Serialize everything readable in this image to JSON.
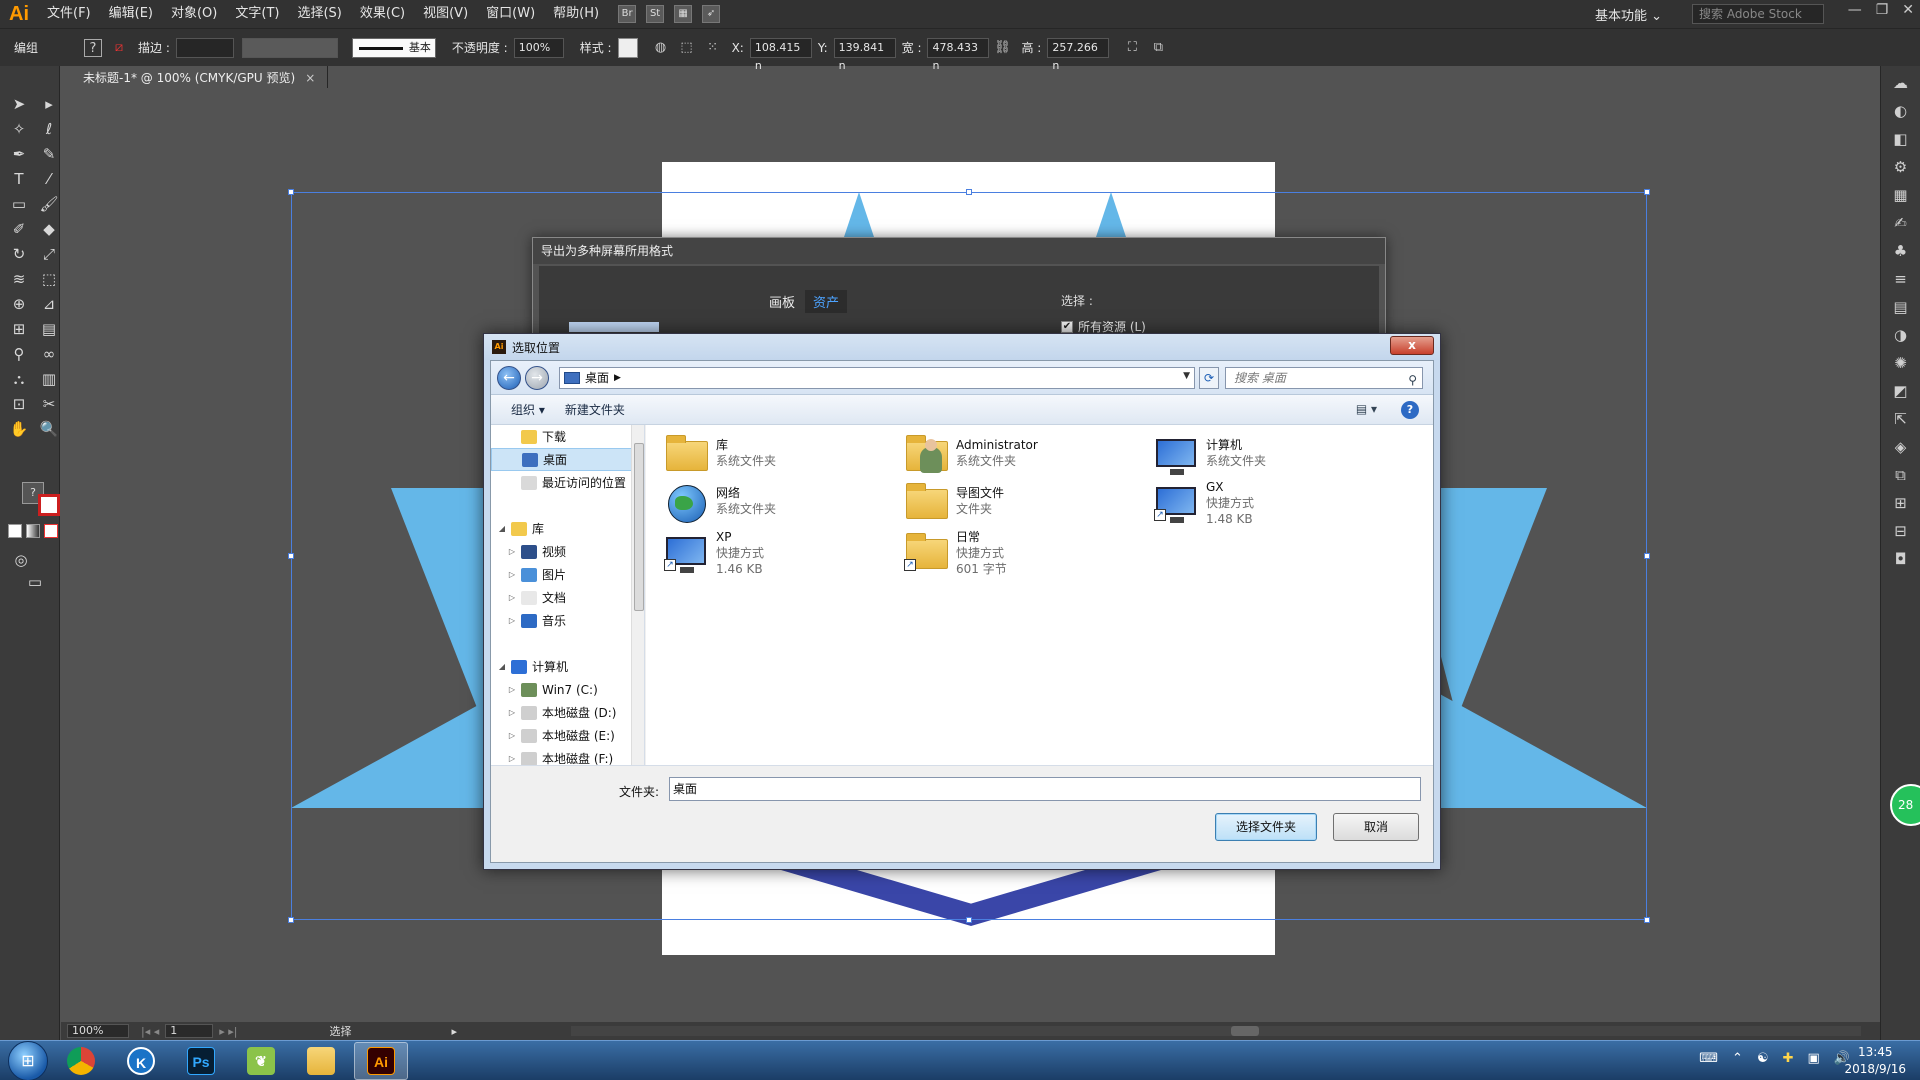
{
  "menubar": {
    "logo": "Ai",
    "items": [
      "文件(F)",
      "编辑(E)",
      "对象(O)",
      "文字(T)",
      "选择(S)",
      "效果(C)",
      "视图(V)",
      "窗口(W)",
      "帮助(H)"
    ],
    "st_label": "St",
    "workspace": "基本功能",
    "stock_search_placeholder": "搜索 Adobe Stock"
  },
  "controlbar": {
    "mode": "编组",
    "stroke_label": "描边 :",
    "stroke_style": "基本",
    "opacity_label": "不透明度 :",
    "opacity_value": "100%",
    "style_label": "样式 :",
    "x_label": "X:",
    "x_value": "108.415 n",
    "y_label": "Y:",
    "y_value": "139.841 n",
    "w_label": "宽 :",
    "w_value": "478.433 n",
    "h_label": "高 :",
    "h_value": "257.266 n"
  },
  "document": {
    "tab_title": "未标题-1* @ 100% (CMYK/GPU 预览)",
    "tab_close": "×",
    "artwork_color": "#64b7e8"
  },
  "export_dialog": {
    "title": "导出为多种屏幕所用格式",
    "tab_artboards": "画板",
    "tab_assets": "资产",
    "select_label": "选择 :",
    "all_assets_label": "所有资源 (L)",
    "all_assets_checked": true
  },
  "picker": {
    "title": "选取位置",
    "title_icon": "Ai",
    "close": "x",
    "address": "桌面",
    "search_placeholder": "搜索 桌面",
    "organize": "组织 ▾",
    "new_folder": "新建文件夹",
    "help": "?",
    "tree": [
      {
        "label": "下载",
        "indent": 1,
        "arrow": ""
      },
      {
        "label": "桌面",
        "indent": 1,
        "arrow": "",
        "selected": true
      },
      {
        "label": "最近访问的位置",
        "indent": 1,
        "arrow": ""
      },
      {
        "label": "",
        "indent": 0,
        "arrow": ""
      },
      {
        "label": "库",
        "indent": 0,
        "arrow": "◢"
      },
      {
        "label": "视频",
        "indent": 1,
        "arrow": "▷"
      },
      {
        "label": "图片",
        "indent": 1,
        "arrow": "▷"
      },
      {
        "label": "文档",
        "indent": 1,
        "arrow": "▷"
      },
      {
        "label": "音乐",
        "indent": 1,
        "arrow": "▷"
      },
      {
        "label": "",
        "indent": 0,
        "arrow": ""
      },
      {
        "label": "计算机",
        "indent": 0,
        "arrow": "◢"
      },
      {
        "label": "Win7 (C:)",
        "indent": 1,
        "arrow": "▷"
      },
      {
        "label": "本地磁盘 (D:)",
        "indent": 1,
        "arrow": "▷"
      },
      {
        "label": "本地磁盘 (E:)",
        "indent": 1,
        "arrow": "▷"
      },
      {
        "label": "本地磁盘 (F:)",
        "indent": 1,
        "arrow": "▷"
      }
    ],
    "files": [
      {
        "name": "库",
        "type": "系统文件夹",
        "size": "",
        "icon": "library-folder-icon"
      },
      {
        "name": "Administrator",
        "type": "系统文件夹",
        "size": "",
        "icon": "user-folder-icon"
      },
      {
        "name": "计算机",
        "type": "系统文件夹",
        "size": "",
        "icon": "computer-icon"
      },
      {
        "name": "网络",
        "type": "系统文件夹",
        "size": "",
        "icon": "network-icon"
      },
      {
        "name": "导图文件",
        "type": "文件夹",
        "size": "",
        "icon": "folder-icon"
      },
      {
        "name": "GX",
        "type": "快捷方式",
        "size": "1.48 KB",
        "icon": "computer-shortcut-icon"
      },
      {
        "name": "XP",
        "type": "快捷方式",
        "size": "1.46 KB",
        "icon": "computer-shortcut-icon"
      },
      {
        "name": "日常",
        "type": "快捷方式",
        "size": "601 字节",
        "icon": "folder-shortcut-icon"
      }
    ],
    "folder_label": "文件夹:",
    "folder_value": "桌面",
    "select_button": "选择文件夹",
    "cancel_button": "取消"
  },
  "statusbar": {
    "zoom": "100%",
    "page": "1",
    "tool": "选择"
  },
  "taskbar": {
    "apps": [
      "Chrome",
      "K",
      "Ps",
      "Leaf",
      "Explorer",
      "Ai"
    ],
    "time": "13:45",
    "date": "2018/9/16"
  },
  "right_badge": "28"
}
